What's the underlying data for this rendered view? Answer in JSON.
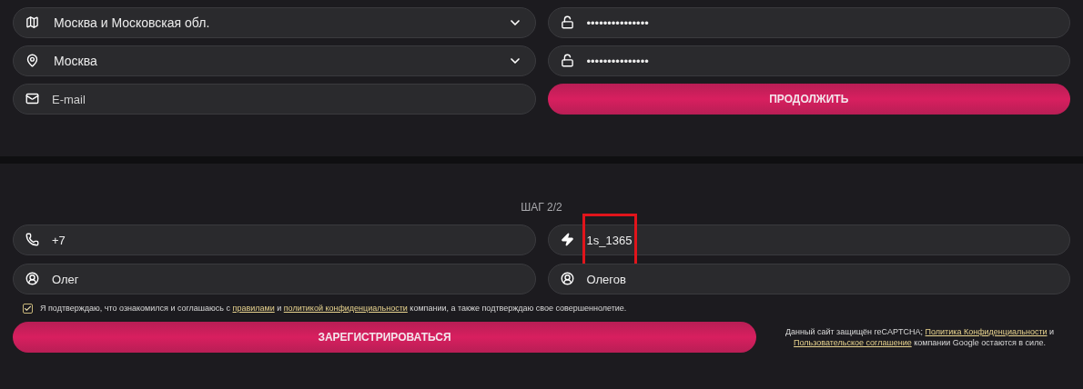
{
  "step1": {
    "left_fields": [
      {
        "kind": "select",
        "value": "Москва и Московская обл."
      },
      {
        "kind": "select_city",
        "value": "Москва"
      },
      {
        "kind": "email",
        "placeholder": "E-mail"
      }
    ],
    "right_fields": [
      {
        "kind": "password",
        "value": "•••••••••••••••"
      },
      {
        "kind": "password",
        "value": "•••••••••••••••"
      }
    ],
    "continue_button": "ПРОДОЛЖИТЬ"
  },
  "step2": {
    "heading": "ШАГ 2/2",
    "fields": [
      {
        "kind": "phone",
        "value": "+7",
        "highlighted": false
      },
      {
        "kind": "promo",
        "value": "1s_1365",
        "highlighted": true
      },
      {
        "kind": "name",
        "value": "Олег",
        "highlighted": false
      },
      {
        "kind": "name",
        "value": "Олегов",
        "highlighted": false
      }
    ],
    "consent": {
      "checked": true,
      "parts": [
        {
          "text": "Я подтверждаю, что ознакомился и соглашаюсь с ",
          "link": false
        },
        {
          "text": "правилами",
          "link": true
        },
        {
          "text": " и ",
          "link": false
        },
        {
          "text": "политикой конфиденциальности",
          "link": true
        },
        {
          "text": " компании, а также подтверждаю свое совершеннолетие.",
          "link": false
        }
      ]
    },
    "register_button": "ЗАРЕГИСТРИРОВАТЬСЯ",
    "recaptcha_notice": [
      {
        "text": "Данный сайт защищён reCAPTCHA; ",
        "link": false
      },
      {
        "text": "Политика Конфиденциальности",
        "link": true
      },
      {
        "text": " и ",
        "link": false
      },
      {
        "text": "Пользовательское соглашение",
        "link": true
      },
      {
        "text": " компании Google остаются в силе.",
        "link": false
      }
    ]
  }
}
